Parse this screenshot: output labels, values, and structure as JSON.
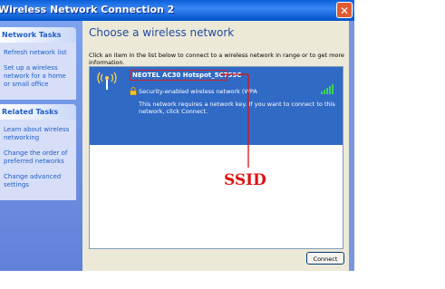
{
  "window": {
    "title": "Wireless Network Connection 2",
    "close_icon": "close-icon"
  },
  "sidebar": {
    "network_tasks": {
      "header": "Network Tasks",
      "items": [
        "Refresh network list",
        "Set up a wireless network for a home or small office"
      ]
    },
    "related_tasks": {
      "header": "Related Tasks",
      "items": [
        "Learn about wireless networking",
        "Change the order of preferred networks",
        "Change advanced settings"
      ]
    }
  },
  "main": {
    "heading": "Choose a wireless network",
    "instructions": "Click an item in the list below to connect to a wireless network in range or to get more information.",
    "networks": [
      {
        "ssid": "NEOTEL AC30 Hotspot_5C759C",
        "security": "Security-enabled wireless network (WPA",
        "info": "This network requires a network key. If you want to connect to this network, click Connect.",
        "selected": true
      }
    ],
    "connect_label": "Connect"
  },
  "annotation": {
    "label": "SSID",
    "color": "#dd1111"
  },
  "colors": {
    "titlebar": "#0a5fd8",
    "sidebar": "#7a96df",
    "selected_item": "#316ac5",
    "heading": "#224aa0"
  }
}
